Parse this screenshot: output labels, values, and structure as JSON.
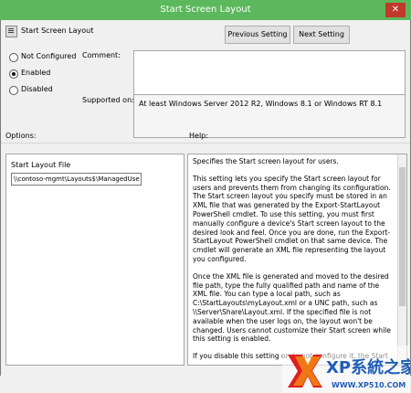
{
  "window": {
    "title": "Start Screen Layout",
    "close": "✕"
  },
  "header": {
    "policy_name": "Start Screen Layout"
  },
  "buttons": {
    "previous": "Previous Setting",
    "next": "Next Setting"
  },
  "radios": [
    {
      "label": "Not Configured",
      "checked": false
    },
    {
      "label": "Enabled",
      "checked": true
    },
    {
      "label": "Disabled",
      "checked": false
    }
  ],
  "labels": {
    "comment": "Comment:",
    "supported_on": "Supported on:",
    "options": "Options:",
    "help": "Help:"
  },
  "supported_value": "At least Windows Server 2012 R2, Windows 8.1 or Windows RT 8.1",
  "options": {
    "field_label": "Start Layout File",
    "field_value": "\\\\contoso-mgmt\\Layouts$\\ManagedUse"
  },
  "help": {
    "paragraphs": [
      "Specifies the Start screen layout for users.",
      "This setting lets you specify the Start screen layout for users and prevents them from changing its configuration. The Start screen layout you specify must be stored in an XML file that was generated by the Export-StartLayout PowerShell cmdlet. To use this setting, you must first manually configure a device's Start screen layout to the desired look and feel. Once you are done, run the Export-StartLayout PowerShell cmdlet on that same device. The cmdlet will generate an XML file representing the layout you configured.",
      "Once the XML file is generated and moved to the desired file path, type the fully qualified path and name of the XML file. You can type a local path, such as C:\\StartLayouts\\myLayout.xml or a UNC path, such as \\\\Server\\Share\\Layout.xml. If the specified file is not available when the user logs on, the layout won't be changed. Users cannot customize their Start screen while this setting is enabled.",
      "If you disable this setting or do not configure it, the Start"
    ]
  },
  "watermark": {
    "brand": "XP系統之家",
    "url": "WWW.XP510.COM"
  },
  "colors": {
    "titlebar": "#5cb85c",
    "watermark_blue": "#1e5eb6"
  }
}
